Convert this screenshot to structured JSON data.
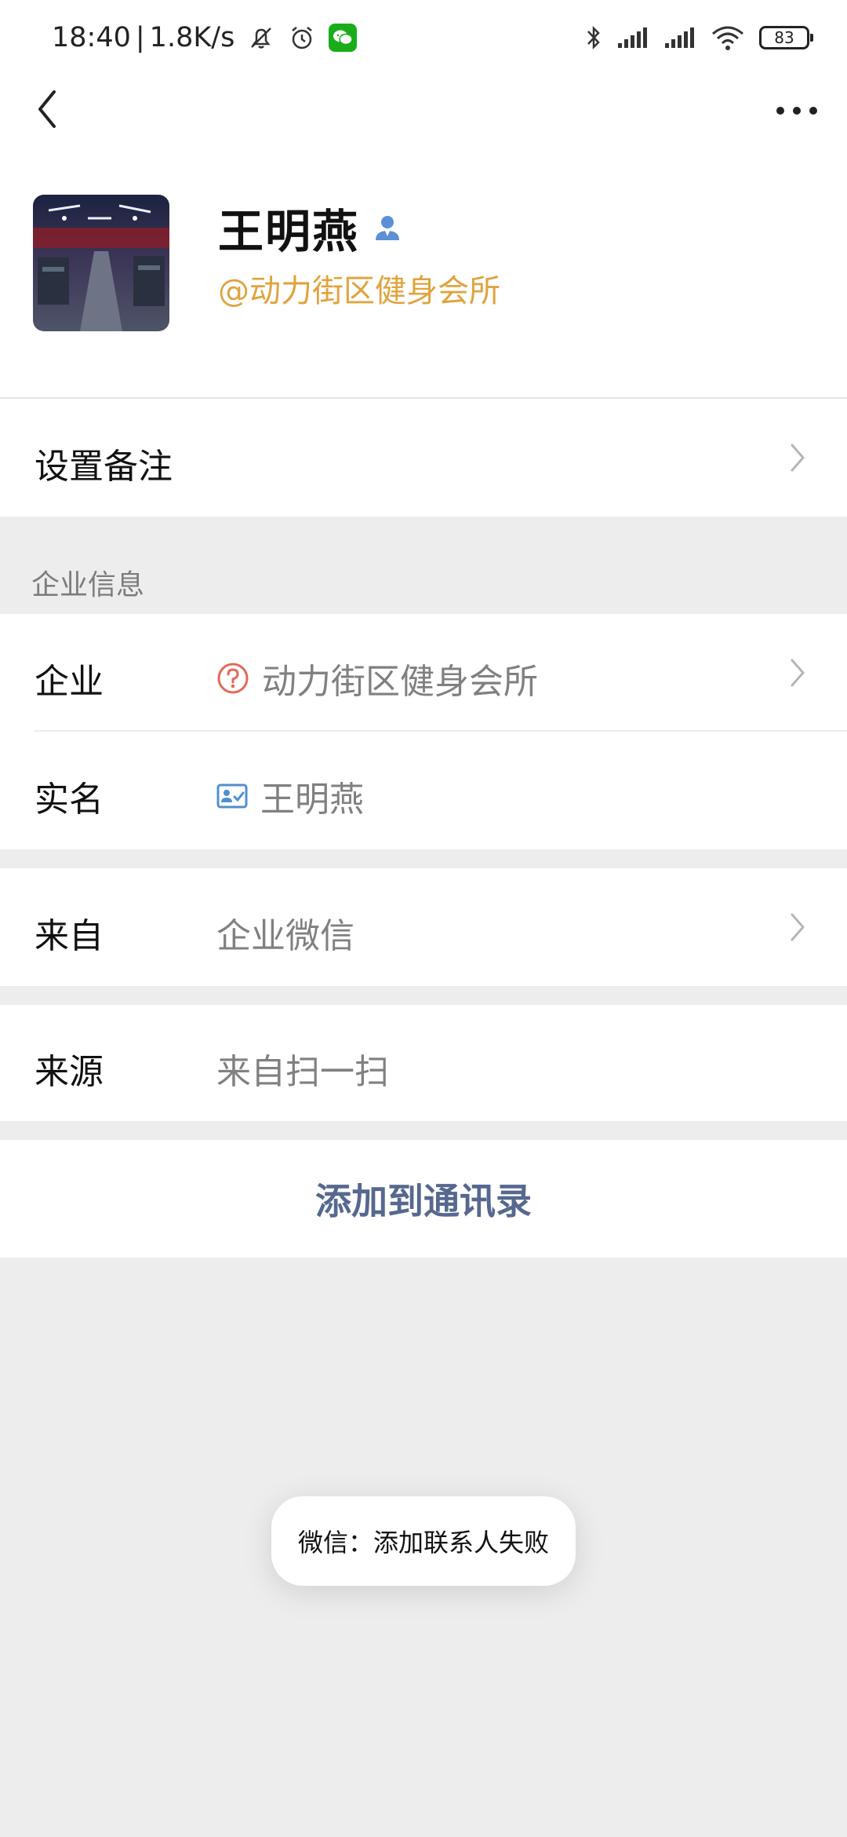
{
  "status_bar": {
    "time": "18:40",
    "separator": "|",
    "net_speed": "1.8K/s",
    "battery_level": "83",
    "icons": [
      "mute-bell-icon",
      "alarm-icon",
      "wechat-icon",
      "bluetooth-icon",
      "signal-icon",
      "signal-icon",
      "wifi-icon",
      "battery-icon"
    ]
  },
  "nav": {
    "back_icon": "chevron-left-icon",
    "more_icon": "more-horizontal-icon"
  },
  "profile": {
    "name": "王明燕",
    "company_tag": "@动力街区健身会所",
    "badge_icon": "person-icon",
    "colors": {
      "company_tag": "#e0a33e",
      "badge": "#5b8fd6"
    }
  },
  "remark": {
    "label": "设置备注"
  },
  "enterprise_section": {
    "header": "企业信息",
    "company": {
      "label": "企业",
      "value": "动力街区健身会所",
      "icon": "question-circle-icon"
    },
    "real_name": {
      "label": "实名",
      "value": "王明燕",
      "icon": "id-card-icon"
    }
  },
  "from": {
    "label": "来自",
    "value": "企业微信"
  },
  "source": {
    "label": "来源",
    "value": "来自扫一扫"
  },
  "actions": {
    "add_to_contacts": "添加到通讯录",
    "color": "#56688f"
  },
  "toast": {
    "message": "微信：添加联系人失败"
  }
}
